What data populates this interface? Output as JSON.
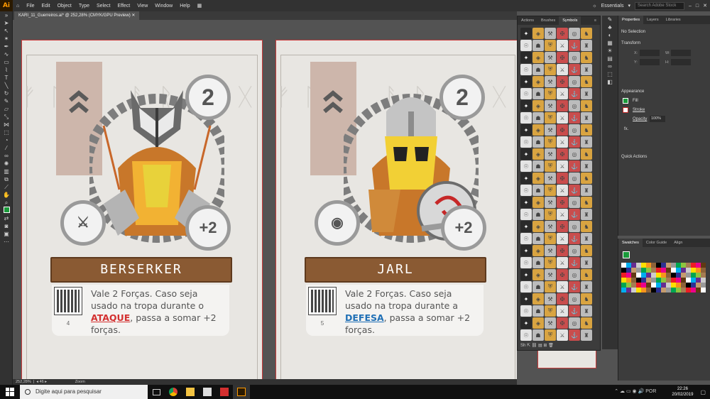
{
  "app": {
    "logo": "Ai",
    "menus": [
      "File",
      "Edit",
      "Object",
      "Type",
      "Select",
      "Effect",
      "View",
      "Window",
      "Help"
    ],
    "workspace": "Essentials",
    "search_placeholder": "Search Adobe Stock"
  },
  "document": {
    "tab_title": "KARI_11_Guerreiros.ai* @ 252,28% (CMYK/GPU Preview)"
  },
  "status": {
    "zoom": "252,28%",
    "artboard_num": "46",
    "tool": "Zoom"
  },
  "cards": [
    {
      "rank": "2",
      "bonus": "+2",
      "name": "BERSERKER",
      "qr_number": "4",
      "desc_before": "Vale 2 Forças. Caso seja usado na tropa durante o ",
      "keyword": "ATAQUE",
      "desc_after": ", passa a somar +2 forças.",
      "keyword_color": "#d32f2f"
    },
    {
      "rank": "2",
      "bonus": "+2",
      "name": "JARL",
      "qr_number": "5",
      "desc_before": "Vale 2 Forças. Caso seja usado na tropa durante a ",
      "keyword": "DEFESA",
      "desc_after": ", passa a somar +2 forças.",
      "keyword_color": "#1f6fb5"
    }
  ],
  "symbols_panel": {
    "tabs": [
      "Actions",
      "Brushes",
      "Symbols"
    ],
    "active_tab": "Symbols",
    "footer_label": "Sh"
  },
  "properties_panel": {
    "tabs": [
      "Properties",
      "Layers",
      "Libraries"
    ],
    "no_selection": "No Selection",
    "transform": "Transform",
    "x_label": "X:",
    "y_label": "Y:",
    "w_label": "W:",
    "h_label": "H:",
    "appearance": "Appearance",
    "fill": "Fill",
    "stroke": "Stroke",
    "opacity_label": "Opacity",
    "opacity": "100%",
    "fx": "fx.",
    "quick_actions": "Quick Actions"
  },
  "swatches_panel": {
    "tabs": [
      "Swatches",
      "Color Guide",
      "Align"
    ]
  },
  "taskbar": {
    "search_placeholder": "Digite aqui para pesquisar",
    "time": "22:26",
    "date": "20/02/2019"
  },
  "colors": {
    "accent": "#ff9a00",
    "artboard_border": "#c83a3a",
    "plank": "#8a5a33"
  }
}
